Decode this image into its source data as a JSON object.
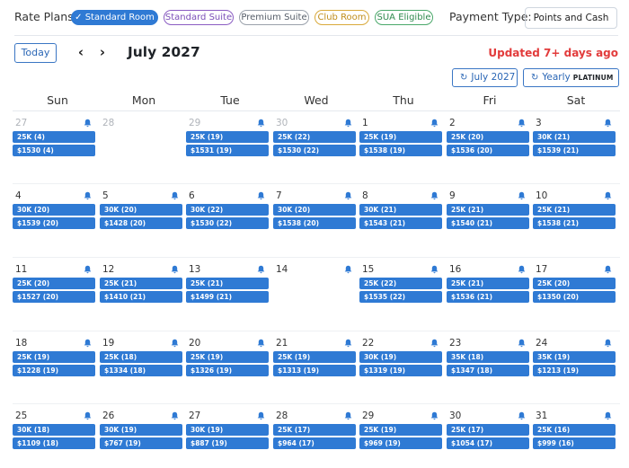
{
  "header": {
    "rate_plans_label": "Rate Plans:",
    "rate_plans": [
      {
        "label": "Standard Room",
        "active": true,
        "color": "#2f7ad4"
      },
      {
        "label": "Standard Suite",
        "active": false,
        "color": "#8a5cc2"
      },
      {
        "label": "Premium Suite",
        "active": false,
        "color": "#7d8591"
      },
      {
        "label": "Club Room",
        "active": false,
        "color": "#d9a93a"
      },
      {
        "label": "SUA Eligible",
        "active": false,
        "color": "#4aa86a"
      }
    ],
    "payment_type_label": "Payment Type:",
    "payment_type_value": "Points and Cash"
  },
  "nav": {
    "today_label": "Today",
    "prev_symbol": "‹",
    "next_symbol": "›",
    "month_title": "July 2027",
    "updated_text": "Updated 7+ days ago",
    "month_button_label": "July 2027",
    "yearly_button_label": "Yearly",
    "yearly_badge": "PLATINUM"
  },
  "calendar": {
    "weekdays": [
      "Sun",
      "Mon",
      "Tue",
      "Wed",
      "Thu",
      "Fri",
      "Sat"
    ],
    "weeks": [
      [
        {
          "day": "27",
          "other": true,
          "bell": true,
          "points": "25K (4)",
          "cash": "$1530 (4)"
        },
        {
          "day": "28",
          "other": true,
          "bell": false,
          "points": "",
          "cash": ""
        },
        {
          "day": "29",
          "other": true,
          "bell": true,
          "points": "25K (19)",
          "cash": "$1531 (19)"
        },
        {
          "day": "30",
          "other": true,
          "bell": true,
          "points": "25K (22)",
          "cash": "$1530 (22)"
        },
        {
          "day": "1",
          "other": false,
          "bell": true,
          "points": "25K (19)",
          "cash": "$1538 (19)"
        },
        {
          "day": "2",
          "other": false,
          "bell": true,
          "points": "25K (20)",
          "cash": "$1536 (20)"
        },
        {
          "day": "3",
          "other": false,
          "bell": true,
          "points": "30K (21)",
          "cash": "$1539 (21)"
        }
      ],
      [
        {
          "day": "4",
          "other": false,
          "bell": true,
          "points": "30K (20)",
          "cash": "$1539 (20)"
        },
        {
          "day": "5",
          "other": false,
          "bell": true,
          "points": "30K (20)",
          "cash": "$1428 (20)"
        },
        {
          "day": "6",
          "other": false,
          "bell": true,
          "points": "30K (22)",
          "cash": "$1530 (22)"
        },
        {
          "day": "7",
          "other": false,
          "bell": true,
          "points": "30K (20)",
          "cash": "$1538 (20)"
        },
        {
          "day": "8",
          "other": false,
          "bell": true,
          "points": "30K (21)",
          "cash": "$1543 (21)"
        },
        {
          "day": "9",
          "other": false,
          "bell": true,
          "points": "25K (21)",
          "cash": "$1540 (21)"
        },
        {
          "day": "10",
          "other": false,
          "bell": true,
          "points": "25K (21)",
          "cash": "$1538 (21)"
        }
      ],
      [
        {
          "day": "11",
          "other": false,
          "bell": true,
          "points": "25K (20)",
          "cash": "$1527 (20)"
        },
        {
          "day": "12",
          "other": false,
          "bell": true,
          "points": "25K (21)",
          "cash": "$1410 (21)"
        },
        {
          "day": "13",
          "other": false,
          "bell": true,
          "points": "25K (21)",
          "cash": "$1499 (21)"
        },
        {
          "day": "14",
          "other": false,
          "bell": true,
          "points": "",
          "cash": ""
        },
        {
          "day": "15",
          "other": false,
          "bell": true,
          "points": "25K (22)",
          "cash": "$1535 (22)"
        },
        {
          "day": "16",
          "other": false,
          "bell": true,
          "points": "25K (21)",
          "cash": "$1536 (21)"
        },
        {
          "day": "17",
          "other": false,
          "bell": true,
          "points": "25K (20)",
          "cash": "$1350 (20)"
        }
      ],
      [
        {
          "day": "18",
          "other": false,
          "bell": true,
          "points": "25K (19)",
          "cash": "$1228 (19)"
        },
        {
          "day": "19",
          "other": false,
          "bell": true,
          "points": "25K (18)",
          "cash": "$1334 (18)"
        },
        {
          "day": "20",
          "other": false,
          "bell": true,
          "points": "25K (19)",
          "cash": "$1326 (19)"
        },
        {
          "day": "21",
          "other": false,
          "bell": true,
          "points": "25K (19)",
          "cash": "$1313 (19)"
        },
        {
          "day": "22",
          "other": false,
          "bell": true,
          "points": "30K (19)",
          "cash": "$1319 (19)"
        },
        {
          "day": "23",
          "other": false,
          "bell": true,
          "points": "35K (18)",
          "cash": "$1347 (18)"
        },
        {
          "day": "24",
          "other": false,
          "bell": true,
          "points": "35K (19)",
          "cash": "$1213 (19)"
        }
      ],
      [
        {
          "day": "25",
          "other": false,
          "bell": true,
          "points": "30K (18)",
          "cash": "$1109 (18)"
        },
        {
          "day": "26",
          "other": false,
          "bell": true,
          "points": "30K (19)",
          "cash": "$767 (19)"
        },
        {
          "day": "27",
          "other": false,
          "bell": true,
          "points": "30K (19)",
          "cash": "$887 (19)"
        },
        {
          "day": "28",
          "other": false,
          "bell": true,
          "points": "25K (17)",
          "cash": "$964 (17)"
        },
        {
          "day": "29",
          "other": false,
          "bell": true,
          "points": "25K (19)",
          "cash": "$969 (19)"
        },
        {
          "day": "30",
          "other": false,
          "bell": true,
          "points": "25K (17)",
          "cash": "$1054 (17)"
        },
        {
          "day": "31",
          "other": false,
          "bell": true,
          "points": "25K (16)",
          "cash": "$999 (16)"
        }
      ]
    ]
  },
  "colors": {
    "accent": "#2f7ad4",
    "alert": "#e23b3b"
  }
}
